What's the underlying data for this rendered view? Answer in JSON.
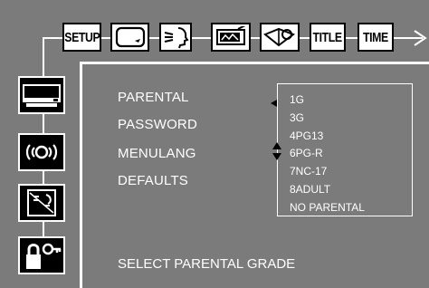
{
  "toolbar": {
    "setup_label": "SETUP",
    "title_label": "TITLE",
    "time_label": "TIME"
  },
  "menu": {
    "items": [
      {
        "label": "PARENTAL"
      },
      {
        "label": "PASSWORD"
      },
      {
        "label": "MENULANG"
      },
      {
        "label": "DEFAULTS"
      }
    ]
  },
  "parental_options": {
    "items": [
      "1G",
      "3G",
      "4PG13",
      "6PG-R",
      "7NC-17",
      "8ADULT",
      "NO PARENTAL"
    ]
  },
  "status": {
    "hint": "SELECT PARENTAL GRADE"
  },
  "colors": {
    "background": "#7c7b7b",
    "foreground": "#ffffff",
    "icon_fill": "#000000"
  }
}
